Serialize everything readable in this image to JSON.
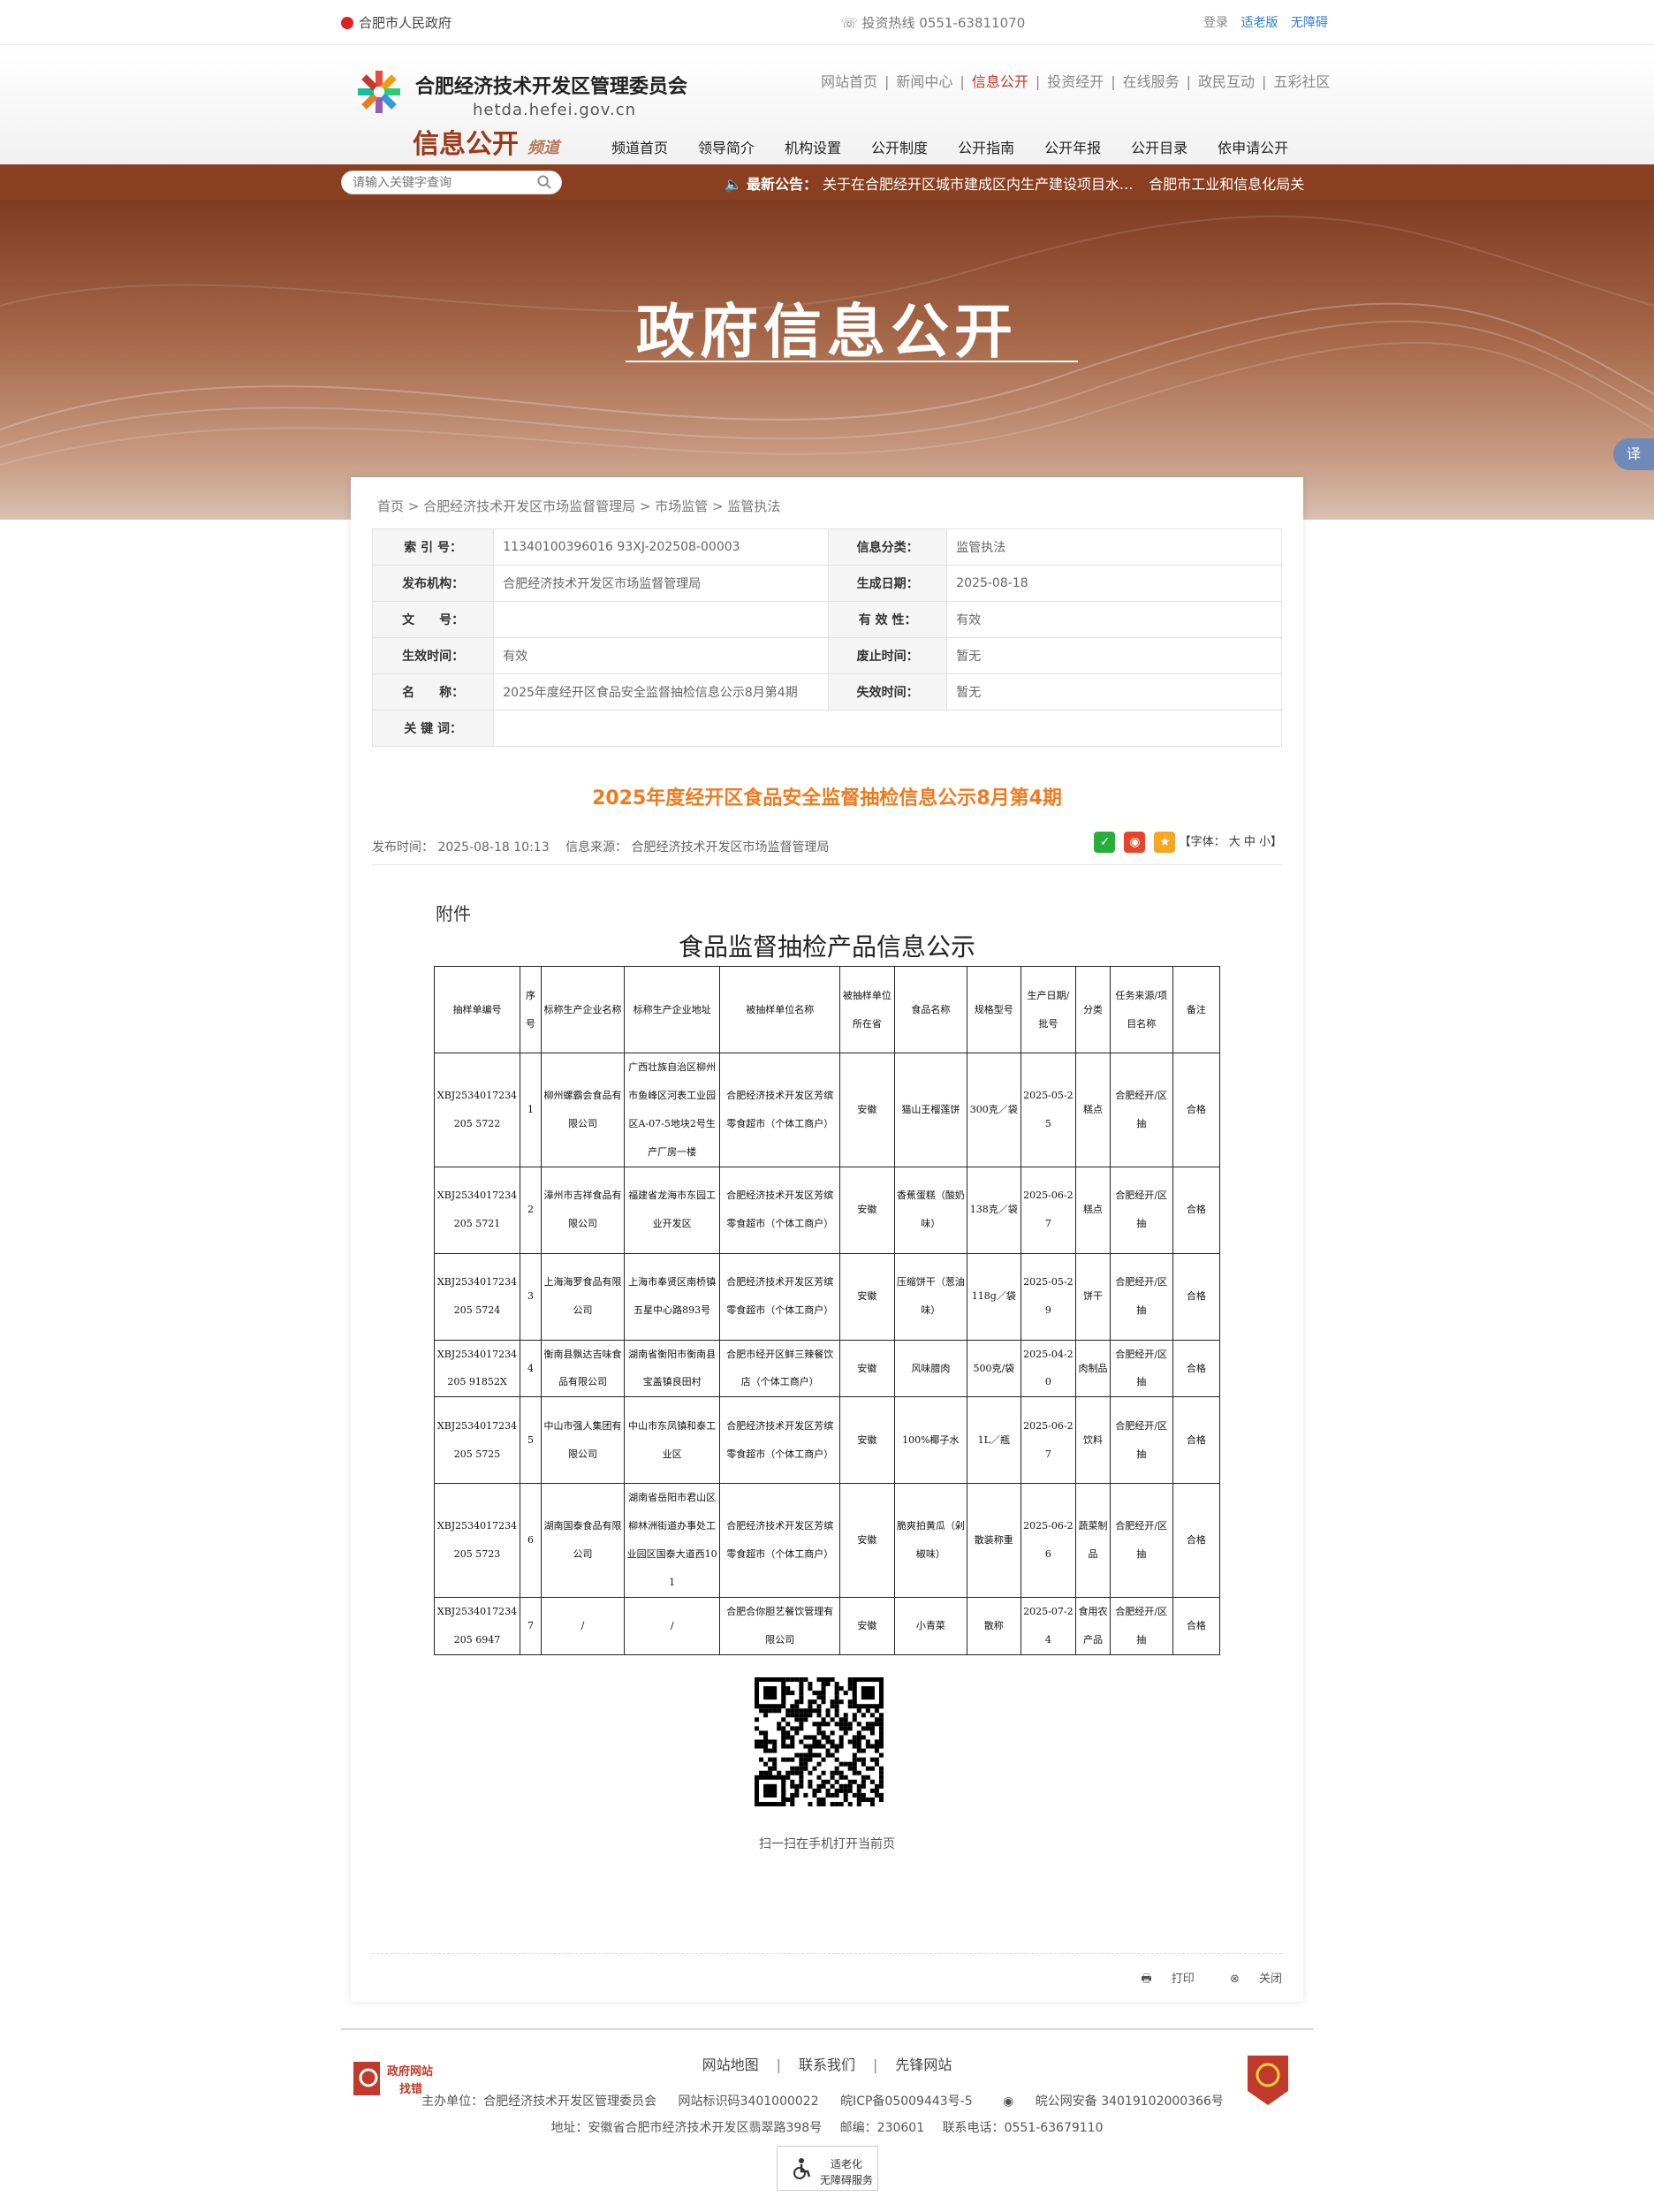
{
  "topbar": {
    "gov_name": "合肥市人民政府",
    "hotline": "投资热线  0551-63811070",
    "login": "登录",
    "elder": "适老版",
    "accessible": "无障碍"
  },
  "header": {
    "site_name": "合肥经济技术开发区管理委员会",
    "site_url": "hetda.hefei.gov.cn",
    "channel": "信息公开",
    "channel_suffix": "频道",
    "top_nav": [
      "网站首页",
      "新闻中心",
      "信息公开",
      "投资经开",
      "在线服务",
      "政民互动",
      "五彩社区"
    ],
    "sub_nav": [
      "频道首页",
      "领导简介",
      "机构设置",
      "公开制度",
      "公开指南",
      "公开年报",
      "公开目录",
      "依申请公开"
    ]
  },
  "search": {
    "placeholder": "请输入关键字查询"
  },
  "notice": {
    "label": "最新公告：",
    "items": [
      "关于在合肥经开区城市建成区内生产建设项目水...",
      "合肥市工业和信息化局关"
    ]
  },
  "banner": {
    "title": "政府信息公开"
  },
  "translate": "译",
  "breadcrumb": [
    "首页",
    "合肥经济技术开发区市场监督管理局",
    "市场监管",
    "监管执法"
  ],
  "meta": {
    "index_label": "索 引 号：",
    "index_value": "11340100396016 93XJ-202508-00003",
    "category_label": "信息分类：",
    "category_value": "监管执法",
    "publisher_label": "发布机构：",
    "publisher_value": "合肥经济技术开发区市场监督管理局",
    "date_label": "生成日期：",
    "date_value": "2025-08-18",
    "doc_no_label": "文　　号：",
    "doc_no_value": "",
    "validity_label": "有 效 性：",
    "validity_value": "有效",
    "effective_label": "生效时间：",
    "effective_value": "有效",
    "repeal_label": "废止时间：",
    "repeal_value": "暂无",
    "name_label": "名　　称：",
    "name_value": "2025年度经开区食品安全监督抽检信息公示8月第4期",
    "expire_label": "失效时间：",
    "expire_value": "暂无",
    "keyword_label": "关 键 词：",
    "keyword_value": ""
  },
  "article": {
    "title": "2025年度经开区食品安全监督抽检信息公示8月第4期",
    "publish_time": "发布时间： 2025-08-18 10:13",
    "source": "信息来源： 合肥经济技术开发区市场监督管理局",
    "font_label": "【字体： 大  中  小】",
    "attachment": "附件",
    "doc_title": "食品监督抽检产品信息公示"
  },
  "table": {
    "headers": [
      "抽样单编号",
      "序号",
      "标称生产企业名称",
      "标称生产企业地址",
      "被抽样单位名称",
      "被抽样单位所在省",
      "食品名称",
      "规格型号",
      "生产日期/批号",
      "分类",
      "任务来源/项目名称",
      "备注"
    ],
    "rows": [
      [
        "XBJ2534017234205 5722",
        "1",
        "柳州螺霸会食品有限公司",
        "广西壮族自治区柳州市鱼峰区河表工业园区A-07-5地块2号生产厂房一楼",
        "合肥经济技术开发区芳缤零食超市（个体工商户）",
        "安徽",
        "猫山王榴莲饼",
        "300克／袋",
        "2025-05-25",
        "糕点",
        "合肥经开/区抽",
        "合格"
      ],
      [
        "XBJ2534017234205 5721",
        "2",
        "漳州市吉祥食品有限公司",
        "福建省龙海市东园工业开发区",
        "合肥经济技术开发区芳缤零食超市（个体工商户）",
        "安徽",
        "香蕉蛋糕（酸奶味）",
        "138克／袋",
        "2025-06-27",
        "糕点",
        "合肥经开/区抽",
        "合格"
      ],
      [
        "XBJ2534017234205 5724",
        "3",
        "上海海罗食品有限公司",
        "上海市奉贤区南桥镇五星中心路893号",
        "合肥经济技术开发区芳缤零食超市（个体工商户）",
        "安徽",
        "压缩饼干（葱油味）",
        "118g／袋",
        "2025-05-29",
        "饼干",
        "合肥经开/区抽",
        "合格"
      ],
      [
        "XBJ2534017234205 91852X",
        "4",
        "衡南县飘达吉味食品有限公司",
        "湖南省衡阳市衡南县宝盖镇良田村",
        "合肥市经开区鲜三辣餐饮店（个体工商户）",
        "安徽",
        "风味腊肉",
        "500克/袋",
        "2025-04-20",
        "肉制品",
        "合肥经开/区抽",
        "合格"
      ],
      [
        "XBJ2534017234205 5725",
        "5",
        "中山市强人集团有限公司",
        "中山市东凤镇和泰工业区",
        "合肥经济技术开发区芳缤零食超市（个体工商户）",
        "安徽",
        "100%椰子水",
        "1L／瓶",
        "2025-06-27",
        "饮料",
        "合肥经开/区抽",
        "合格"
      ],
      [
        "XBJ2534017234205 5723",
        "6",
        "湖南国泰食品有限公司",
        "湖南省岳阳市君山区柳林洲街道办事处工业园区国泰大道西101",
        "合肥经济技术开发区芳缤零食超市（个体工商户）",
        "安徽",
        "脆爽拍黄瓜（剁椒味）",
        "散装称重",
        "2025-06-26",
        "蔬菜制品",
        "合肥经开/区抽",
        "合格"
      ],
      [
        "XBJ2534017234205 6947",
        "7",
        "/",
        "/",
        "合肥合你胆艺餐饮管理有限公司",
        "安徽",
        "小青菜",
        "散称",
        "2025-07-24",
        "食用农产品",
        "合肥经开/区抽",
        "合格"
      ]
    ]
  },
  "qr_caption": "扫一扫在手机打开当前页",
  "actions": {
    "print": "打印",
    "close": "关闭"
  },
  "footer": {
    "links": [
      "网站地图",
      "联系我们",
      "先锋网站"
    ],
    "sep": "|",
    "badge_top": "政府网站",
    "badge_bottom": "找错",
    "host": "主办单位：合肥经济技术开发区管理委员会",
    "site_code": "网站标识码3401000022",
    "icp": "皖ICP备05009443号-5",
    "police": "皖公网安备 34019102000366号",
    "address": "地址：安徽省合肥市经济技术开发区翡翠路398号",
    "postcode": "邮编：230601",
    "phone": "联系电话：0551-63679110",
    "aging_line1": "适老化",
    "aging_line2": "无障碍服务"
  },
  "colors": {
    "brand_brown": "#8a4020",
    "title_orange": "#f07a1e",
    "link_blue": "#2b7cd3"
  }
}
